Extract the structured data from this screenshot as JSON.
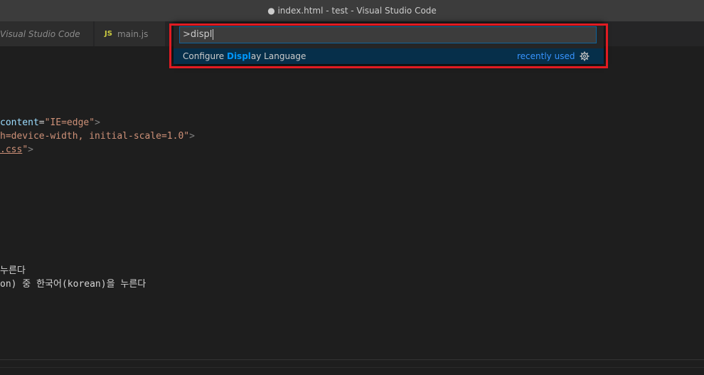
{
  "window": {
    "title": "● index.html - test - Visual Studio Code"
  },
  "tabs": [
    {
      "label": "Visual Studio Code"
    },
    {
      "icon": "JS",
      "label": "main.js"
    }
  ],
  "quick_open": {
    "input_value": ">displ",
    "item": {
      "label_prefix": "Configure ",
      "label_match": "Displ",
      "label_suffix": "ay Language",
      "badge": "recently used"
    }
  },
  "code_lines": {
    "l1_attr": "content",
    "l1_eq": "=",
    "l1_str": "\"IE=edge\"",
    "l1_close": ">",
    "l2_str": "h=device-width, initial-scale=1.0\"",
    "l2_close": ">",
    "l3_str": ".css",
    "l3_str2": "\"",
    "l3_close": ">",
    "l4_text": "누른다",
    "l5_text": "on) 중 한국어(korean)을 누른다"
  },
  "colors": {
    "highlight": "#e11b22",
    "accent": "#0097fb"
  }
}
